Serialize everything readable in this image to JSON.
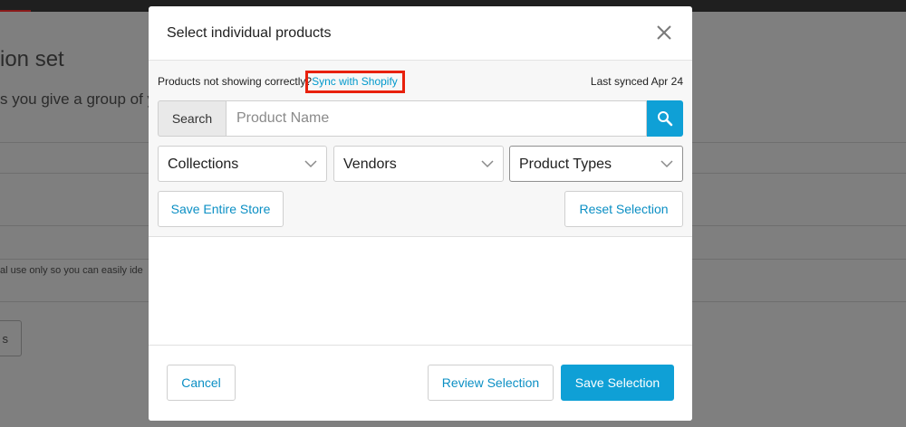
{
  "background": {
    "title": "ion set",
    "subtitle": "s you give a group of y",
    "note": "al use only so you can easily ide",
    "button_label": "s"
  },
  "modal": {
    "title": "Select individual products",
    "close_icon": "close-icon",
    "sync_prompt": "Products not showing correctly?",
    "sync_link": "Sync with Shopify",
    "last_synced": "Last synced Apr 24",
    "search": {
      "label": "Search",
      "placeholder": "Product Name",
      "value": "",
      "icon": "search-icon"
    },
    "filters": [
      {
        "label": "Collections"
      },
      {
        "label": "Vendors"
      },
      {
        "label": "Product Types"
      }
    ],
    "save_store_label": "Save Entire Store",
    "reset_label": "Reset Selection",
    "cancel_label": "Cancel",
    "review_label": "Review Selection",
    "save_label": "Save Selection"
  },
  "colors": {
    "accent": "#0fa0d6",
    "link": "#0099cc",
    "highlight": "#e8200c",
    "overlay": "#7f7f7f"
  }
}
